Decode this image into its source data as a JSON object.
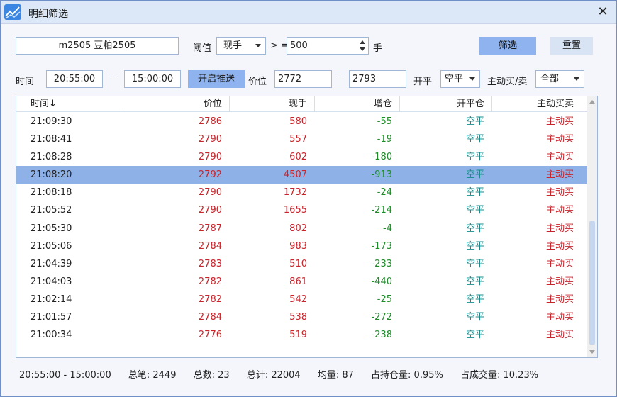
{
  "window": {
    "title": "明细筛选",
    "close_glyph": "✕"
  },
  "filter_row1": {
    "contract": "m2505 豆粕2505",
    "threshold_label": "阈值",
    "threshold_type": "现手",
    "operator": "> =",
    "threshold_value": "500",
    "unit": "手",
    "filter_button": "筛选",
    "reset_button": "重置"
  },
  "filter_row2": {
    "time_label": "时间",
    "time_from": "20:55:00",
    "dash": "—",
    "time_to": "15:00:00",
    "push_button": "开启推送",
    "price_label": "价位",
    "price_from": "2772",
    "price_to": "2793",
    "openclose_label": "开平",
    "openclose_value": "空平",
    "side_label": "主动买/卖",
    "side_value": "全部"
  },
  "table": {
    "columns": [
      "时间↓",
      "价位",
      "现手",
      "增仓",
      "开平仓",
      "主动买卖"
    ],
    "selected_row": 3,
    "rows": [
      {
        "time": "21:09:30",
        "price": "2786",
        "volume": "580",
        "oi_change": "-55",
        "open_close": "空平",
        "side": "主动买"
      },
      {
        "time": "21:08:41",
        "price": "2790",
        "volume": "557",
        "oi_change": "-19",
        "open_close": "空平",
        "side": "主动买"
      },
      {
        "time": "21:08:28",
        "price": "2790",
        "volume": "602",
        "oi_change": "-180",
        "open_close": "空平",
        "side": "主动买"
      },
      {
        "time": "21:08:20",
        "price": "2792",
        "volume": "4507",
        "oi_change": "-913",
        "open_close": "空平",
        "side": "主动买"
      },
      {
        "time": "21:08:18",
        "price": "2790",
        "volume": "1732",
        "oi_change": "-24",
        "open_close": "空平",
        "side": "主动买"
      },
      {
        "time": "21:05:52",
        "price": "2790",
        "volume": "1655",
        "oi_change": "-214",
        "open_close": "空平",
        "side": "主动买"
      },
      {
        "time": "21:05:30",
        "price": "2787",
        "volume": "802",
        "oi_change": "-4",
        "open_close": "空平",
        "side": "主动买"
      },
      {
        "time": "21:05:06",
        "price": "2784",
        "volume": "983",
        "oi_change": "-173",
        "open_close": "空平",
        "side": "主动买"
      },
      {
        "time": "21:04:39",
        "price": "2783",
        "volume": "510",
        "oi_change": "-233",
        "open_close": "空平",
        "side": "主动买"
      },
      {
        "time": "21:04:03",
        "price": "2782",
        "volume": "861",
        "oi_change": "-440",
        "open_close": "空平",
        "side": "主动买"
      },
      {
        "time": "21:02:14",
        "price": "2782",
        "volume": "542",
        "oi_change": "-25",
        "open_close": "空平",
        "side": "主动买"
      },
      {
        "time": "21:01:57",
        "price": "2784",
        "volume": "538",
        "oi_change": "-272",
        "open_close": "空平",
        "side": "主动买"
      },
      {
        "time": "21:00:34",
        "price": "2776",
        "volume": "519",
        "oi_change": "-238",
        "open_close": "空平",
        "side": "主动买"
      }
    ]
  },
  "footer": {
    "time_range": "20:55:00 - 15:00:00",
    "total_trades": "总笔: 2449",
    "count": "总数: 23",
    "total": "总计: 22004",
    "average": "均量: 87",
    "oi_ratio": "占持仓量: 0.95%",
    "volume_ratio": "占成交量: 10.23%"
  },
  "colors": {
    "red": "#c8242b",
    "green": "#1f8a2a",
    "teal": "#178a8a",
    "selected_row": "#8eb2e8",
    "primary_button": "#8eb3ef"
  }
}
